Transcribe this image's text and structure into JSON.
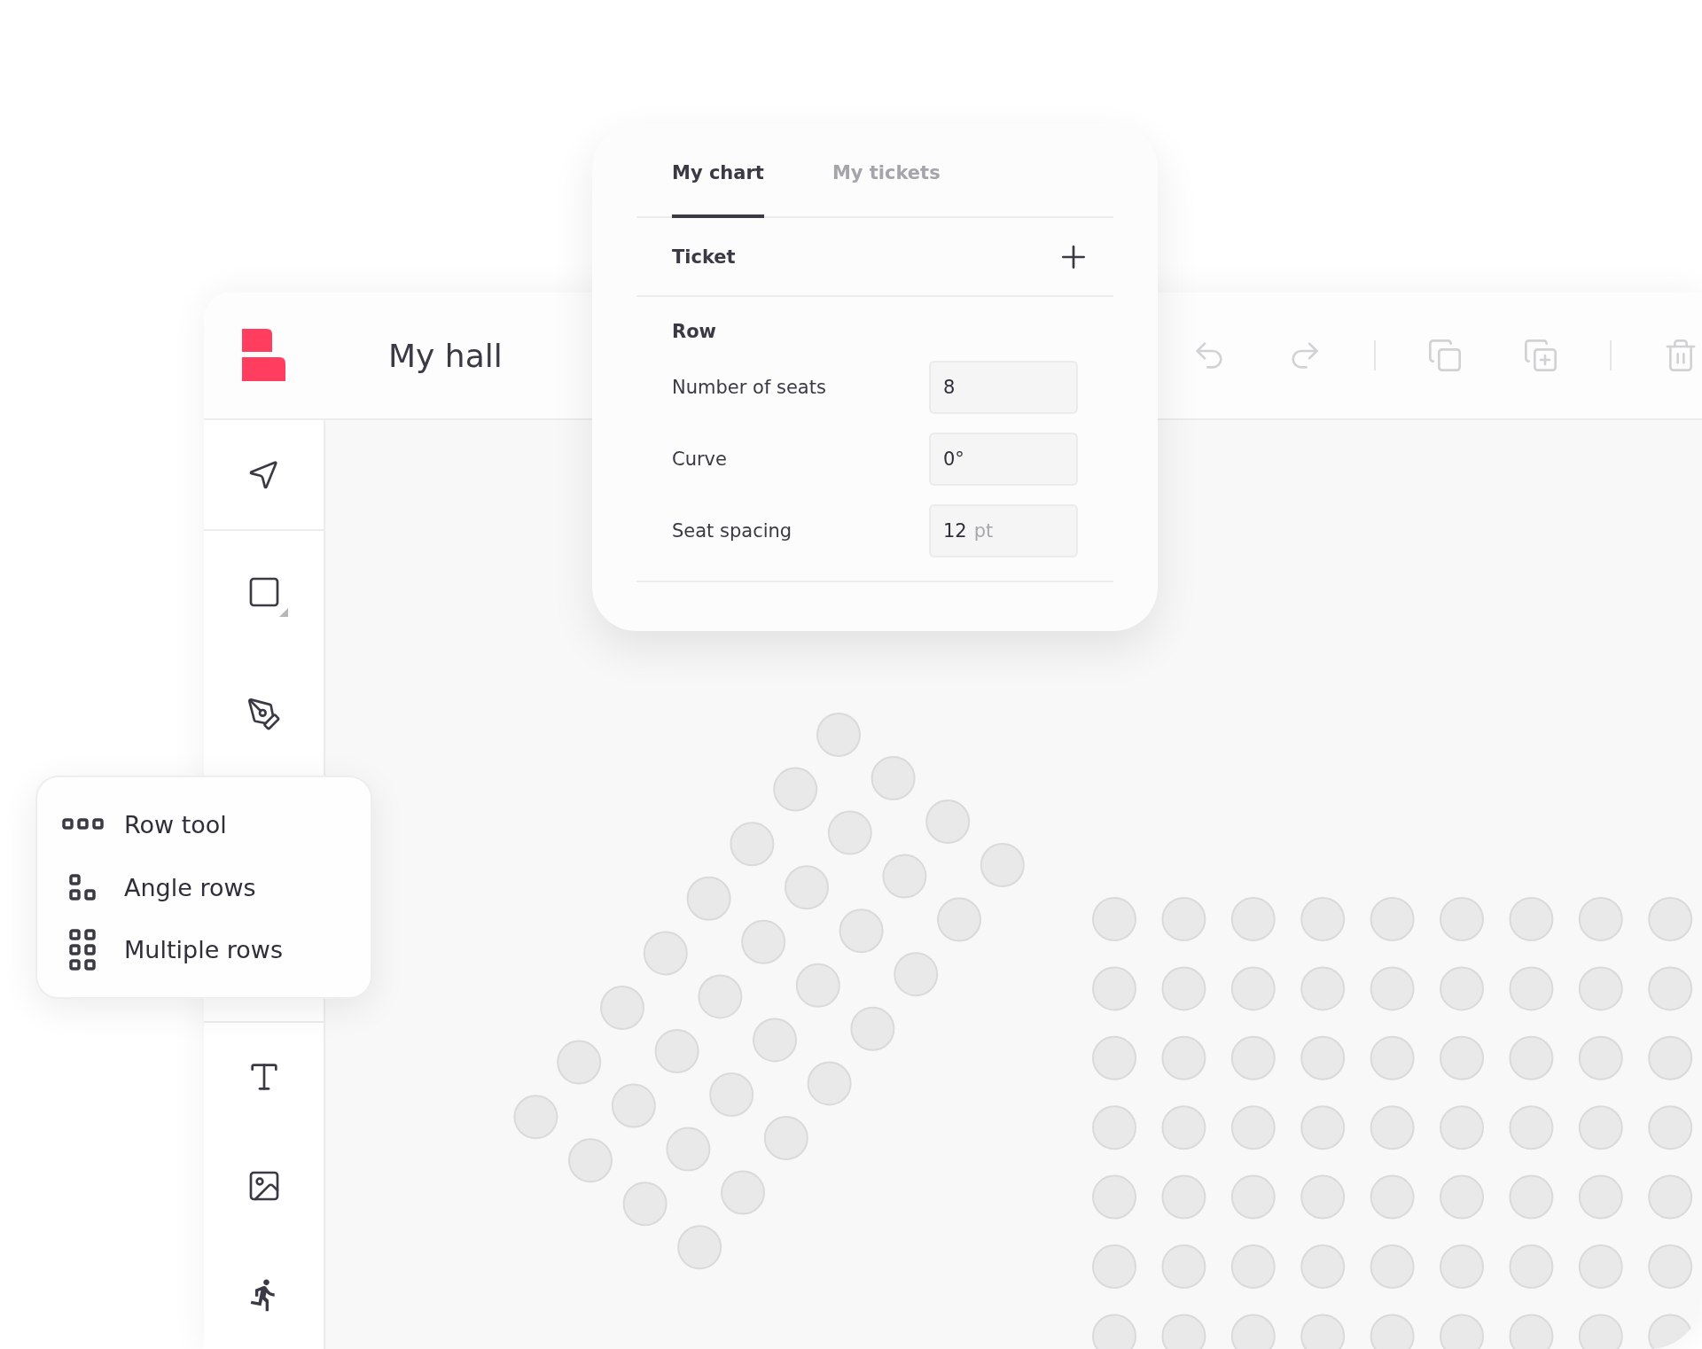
{
  "app": {
    "title": "My hall"
  },
  "action_groups": [
    {
      "actions": [
        {
          "kind": "undo",
          "disabled": true
        },
        {
          "kind": "redo",
          "disabled": true
        }
      ]
    },
    {
      "actions": [
        {
          "kind": "copy",
          "disabled": true
        },
        {
          "kind": "duplicate",
          "disabled": true
        }
      ]
    },
    {
      "actions": [
        {
          "kind": "delete",
          "disabled": true
        }
      ]
    }
  ],
  "tool_groups": [
    {
      "tools": [
        {
          "kind": "select",
          "has_submenu": false
        }
      ]
    },
    {
      "tools": [
        {
          "kind": "shape",
          "has_submenu": true
        },
        {
          "kind": "pen",
          "has_submenu": false
        }
      ]
    },
    {
      "tools": [
        {
          "kind": "text",
          "has_submenu": false
        },
        {
          "kind": "image",
          "has_submenu": false
        },
        {
          "kind": "exit",
          "has_submenu": false
        }
      ]
    }
  ],
  "panel": {
    "tabs": [
      {
        "label": "My chart",
        "selected": true
      },
      {
        "label": "My tickets",
        "selected": false
      }
    ],
    "ticket": {
      "label": "Ticket"
    },
    "row": {
      "title": "Row",
      "fields": [
        {
          "label": "Number of seats",
          "value": "8"
        },
        {
          "label": "Curve",
          "value": "0°"
        },
        {
          "label": "Seat spacing",
          "value": "12",
          "unit": "pt"
        }
      ]
    }
  },
  "tool_menu": {
    "items": [
      {
        "kind": "row",
        "label": "Row tool"
      },
      {
        "kind": "angle",
        "label": "Angle rows"
      },
      {
        "kind": "multiple",
        "label": "Multiple rows"
      }
    ]
  }
}
